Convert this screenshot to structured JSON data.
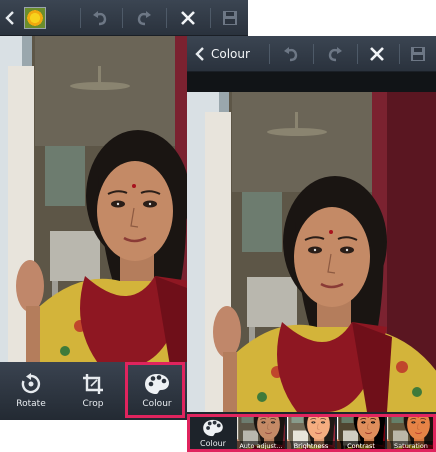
{
  "left_screen": {
    "toolbar": {
      "back_icon": "chevron-left-icon",
      "thumbnail_icon": "flower-thumbnail-icon",
      "undo_icon": "undo-icon",
      "redo_icon": "redo-icon",
      "close_icon": "close-icon",
      "save_icon": "save-icon"
    },
    "tools": [
      {
        "label": "Rotate",
        "icon": "rotate-icon"
      },
      {
        "label": "Crop",
        "icon": "crop-icon"
      },
      {
        "label": "Colour",
        "icon": "palette-icon",
        "highlighted": true
      }
    ]
  },
  "right_screen": {
    "toolbar": {
      "title": "Colour",
      "back_icon": "chevron-left-icon",
      "undo_icon": "undo-icon",
      "redo_icon": "redo-icon",
      "close_icon": "close-icon",
      "save_icon": "save-icon"
    },
    "filter_strip": {
      "current": {
        "label": "Colour",
        "icon": "palette-icon"
      },
      "filters": [
        {
          "label": "Auto adjust..."
        },
        {
          "label": "Brightness"
        },
        {
          "label": "Contrast"
        },
        {
          "label": "Saturation"
        }
      ]
    }
  },
  "colors": {
    "highlight": "#e0245e",
    "toolbar_bg": "#2f3844",
    "icon_fg": "#dfe4ea",
    "icon_dim": "#6d7785"
  }
}
